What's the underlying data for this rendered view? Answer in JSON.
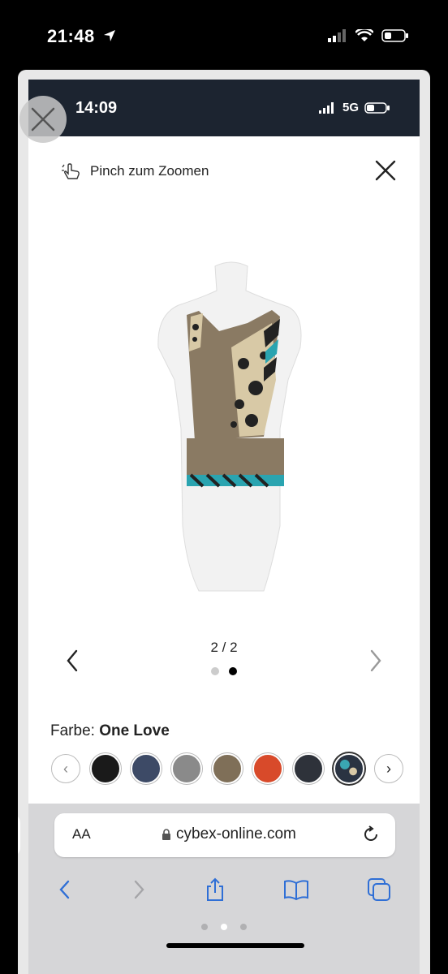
{
  "outer_status": {
    "time": "21:48"
  },
  "inner_status": {
    "time": "14:09",
    "network": "5G"
  },
  "viewer": {
    "hint": "Pinch zum Zoomen",
    "pager": "2 / 2"
  },
  "color": {
    "label": "Farbe:",
    "value": "One Love"
  },
  "swatches": [
    {
      "name": "black",
      "color": "#1a1a1a"
    },
    {
      "name": "navy",
      "color": "#3d4a66"
    },
    {
      "name": "grey",
      "color": "#8a8a8a"
    },
    {
      "name": "taupe",
      "color": "#7f6f58"
    },
    {
      "name": "red",
      "color": "#d84a2a"
    },
    {
      "name": "dark-grey",
      "color": "#2e323a"
    },
    {
      "name": "one-love",
      "color": "#2a3342"
    }
  ],
  "browser": {
    "aa": "AA",
    "url": "cybex-online.com"
  }
}
